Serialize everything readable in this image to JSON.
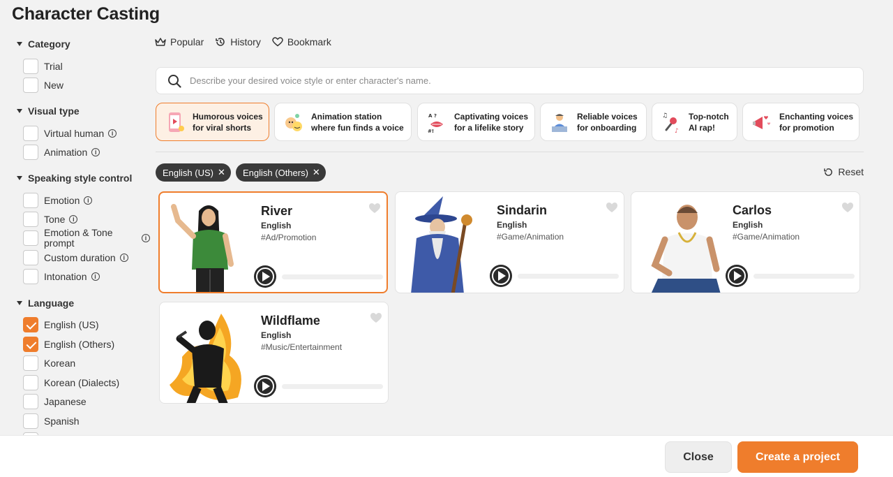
{
  "title": "Character Casting",
  "sidebar": {
    "sections": [
      {
        "label": "Category",
        "options": [
          {
            "label": "Trial",
            "checked": false,
            "info": false
          },
          {
            "label": "New",
            "checked": false,
            "info": false
          }
        ]
      },
      {
        "label": "Visual type",
        "options": [
          {
            "label": "Virtual human",
            "checked": false,
            "info": true
          },
          {
            "label": "Animation",
            "checked": false,
            "info": true
          }
        ]
      },
      {
        "label": "Speaking style control",
        "options": [
          {
            "label": "Emotion",
            "checked": false,
            "info": true
          },
          {
            "label": "Tone",
            "checked": false,
            "info": true
          },
          {
            "label": "Emotion & Tone prompt",
            "checked": false,
            "info": true
          },
          {
            "label": "Custom duration",
            "checked": false,
            "info": true
          },
          {
            "label": "Intonation",
            "checked": false,
            "info": true
          }
        ]
      },
      {
        "label": "Language",
        "options": [
          {
            "label": "English (US)",
            "checked": true,
            "info": false
          },
          {
            "label": "English (Others)",
            "checked": true,
            "info": false
          },
          {
            "label": "Korean",
            "checked": false,
            "info": false
          },
          {
            "label": "Korean (Dialects)",
            "checked": false,
            "info": false
          },
          {
            "label": "Japanese",
            "checked": false,
            "info": false
          },
          {
            "label": "Spanish",
            "checked": false,
            "info": false
          }
        ]
      }
    ]
  },
  "tabs": [
    {
      "label": "Popular",
      "icon": "crown-icon"
    },
    {
      "label": "History",
      "icon": "history-icon"
    },
    {
      "label": "Bookmark",
      "icon": "heart-icon"
    }
  ],
  "search": {
    "placeholder": "Describe your desired voice style or enter character's name.",
    "value": ""
  },
  "presets": [
    {
      "line1": "Humorous voices",
      "line2": "for viral shorts",
      "active": true
    },
    {
      "line1": "Animation station",
      "line2": "where fun finds a voice",
      "active": false
    },
    {
      "line1": "Captivating voices",
      "line2": "for a lifelike story",
      "active": false
    },
    {
      "line1": "Reliable voices",
      "line2": "for onboarding",
      "active": false
    },
    {
      "line1": "Top-notch",
      "line2": "AI rap!",
      "active": false
    },
    {
      "line1": "Enchanting voices",
      "line2": "for promotion",
      "active": false
    }
  ],
  "filters": [
    {
      "label": "English (US)"
    },
    {
      "label": "English (Others)"
    }
  ],
  "reset_label": "Reset",
  "characters": [
    {
      "name": "River",
      "language": "English",
      "tag": "#Ad/Promotion",
      "selected": true
    },
    {
      "name": "Sindarin",
      "language": "English",
      "tag": "#Game/Animation",
      "selected": false
    },
    {
      "name": "Carlos",
      "language": "English",
      "tag": "#Game/Animation",
      "selected": false
    },
    {
      "name": "Wildflame",
      "language": "English",
      "tag": "#Music/Entertainment",
      "selected": false
    }
  ],
  "footer": {
    "close_label": "Close",
    "create_label": "Create a project"
  },
  "colors": {
    "accent": "#ef7d2c",
    "chip": "#3a3a3a"
  }
}
